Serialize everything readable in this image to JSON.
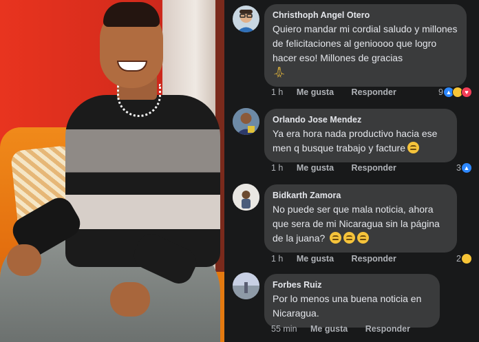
{
  "comments": [
    {
      "author": "Christhoph Angel Otero",
      "text": "Quiero mandar mi cordial saludo y millones de felicitaciones al genioooo que logro hacer eso! Millones de gracias",
      "emoji": "🙏",
      "time": "1 h",
      "like_label": "Me gusta",
      "reply_label": "Responder",
      "reaction_count": "9",
      "reactions": [
        "like-icon",
        "haha-icon",
        "love-icon"
      ]
    },
    {
      "author": "Orlando Jose Mendez",
      "text": "Ya era hora nada productivo hacia ese men q busque trabajo y facture",
      "emoji": "smirk-emoji",
      "time": "1 h",
      "like_label": "Me gusta",
      "reply_label": "Responder",
      "reaction_count": "3",
      "reactions": [
        "like-icon"
      ]
    },
    {
      "author": "Bidkarth Zamora",
      "text": "No puede ser que mala noticia, ahora que sera de mi Nicaragua sin la página de la juana?",
      "emoji": "disappointed-emoji x3",
      "time": "1 h",
      "like_label": "Me gusta",
      "reply_label": "Responder",
      "reaction_count": "2",
      "reactions": [
        "haha-icon"
      ]
    },
    {
      "author": "Forbes Ruiz",
      "text": "Por lo menos una buena noticia en Nicaragua.",
      "time": "55 min",
      "like_label": "Me gusta",
      "reply_label": "Responder"
    }
  ],
  "colors": {
    "background": "#18191a",
    "bubble": "#3a3b3c",
    "text_primary": "#e4e6eb",
    "text_secondary": "#b0b3b8",
    "like": "#2d88ff",
    "love": "#f33e58",
    "haha": "#f7c436"
  }
}
